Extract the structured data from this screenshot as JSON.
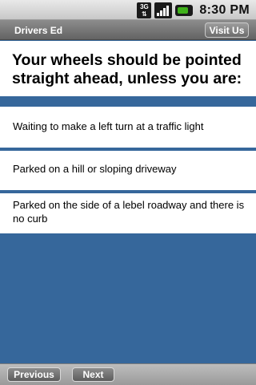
{
  "status_bar": {
    "network": "3G",
    "time": "8:30 PM",
    "icons": [
      "3g-icon",
      "signal-icon",
      "battery-icon"
    ]
  },
  "header": {
    "title": "Drivers Ed",
    "visit_button": "Visit Us"
  },
  "question": {
    "text": "Your wheels should be pointed straight ahead, unless you are:"
  },
  "answers": [
    {
      "label": "Waiting to make a left turn at a traffic light"
    },
    {
      "label": "Parked on a hill or sloping driveway"
    },
    {
      "label": "Parked on the side of a lebel roadway and there is no curb"
    }
  ],
  "footer": {
    "previous_button": "Previous",
    "next_button": "Next"
  },
  "colors": {
    "background": "#36679b",
    "title_bar": "#6f6f6f",
    "battery": "#3fb11a"
  }
}
